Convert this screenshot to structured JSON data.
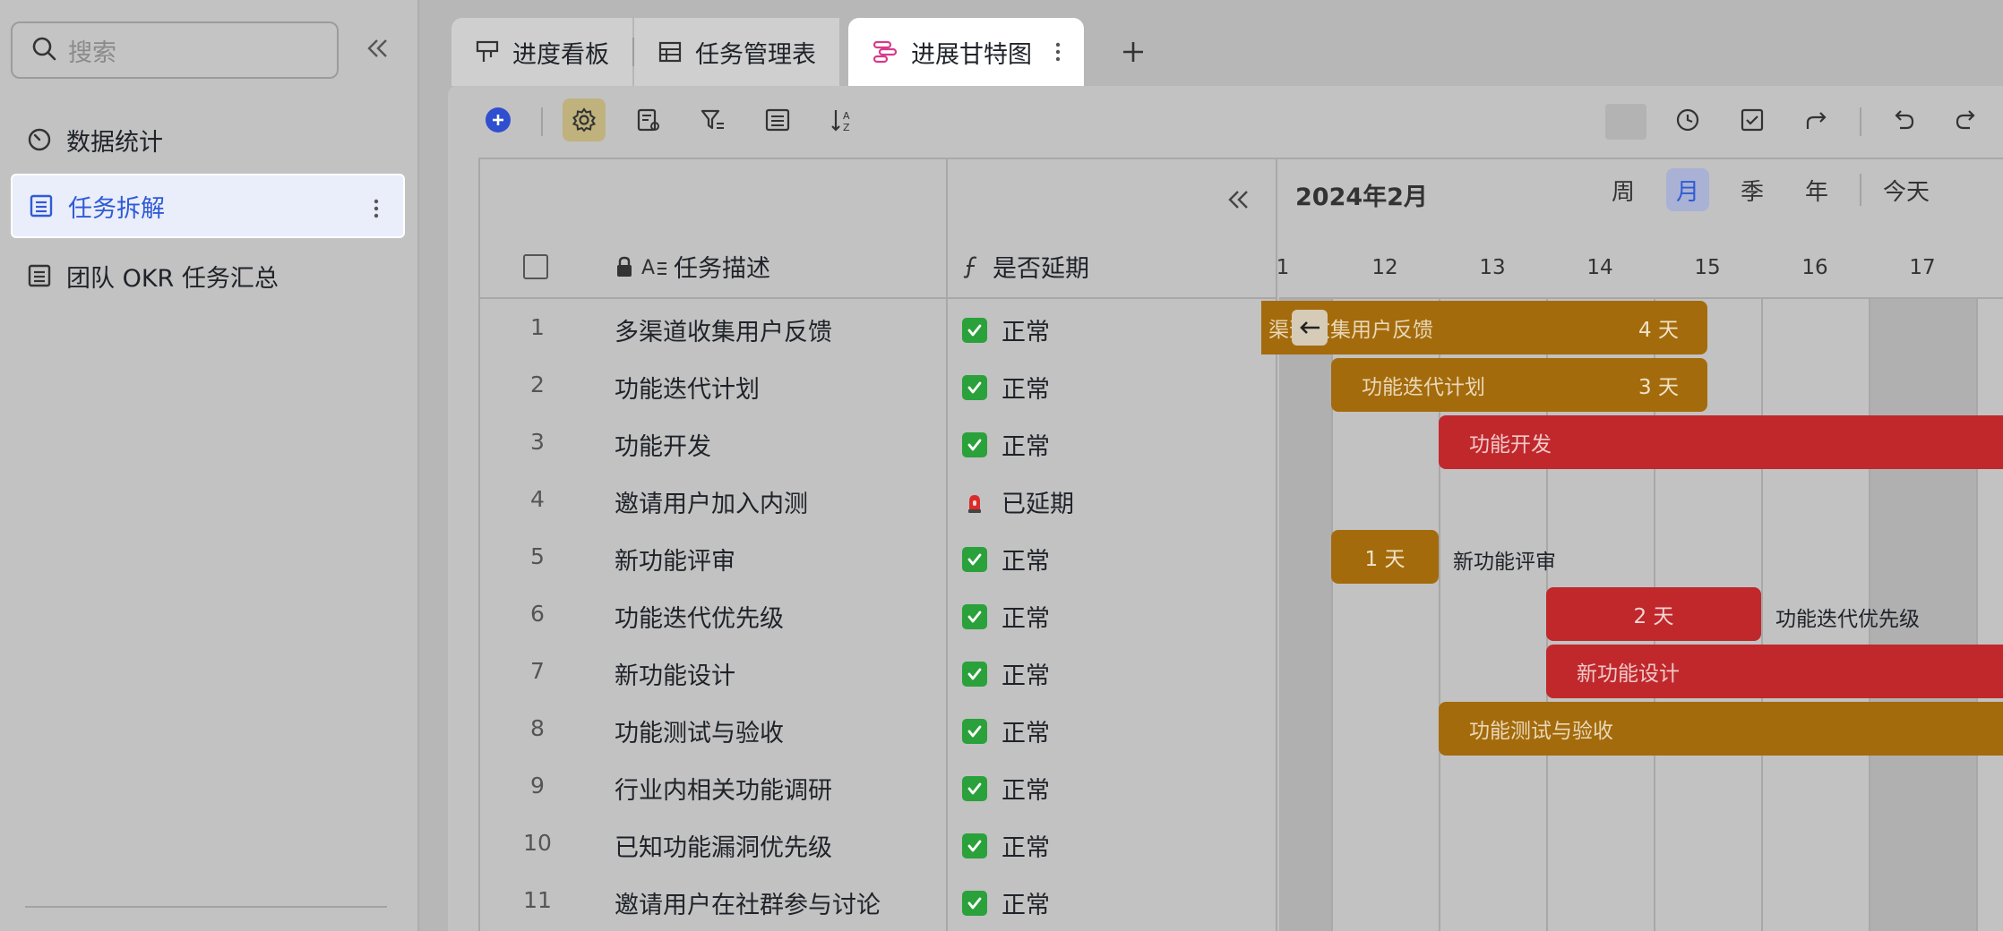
{
  "sidebar": {
    "search_placeholder": "搜索",
    "items": [
      {
        "label": "数据统计",
        "icon": "dashboard-icon"
      },
      {
        "label": "任务拆解",
        "icon": "table-icon",
        "active": true
      },
      {
        "label": "团队 OKR 任务汇总",
        "icon": "table-icon"
      }
    ]
  },
  "tabs": [
    {
      "label": "进度看板",
      "icon": "kanban-icon"
    },
    {
      "label": "任务管理表",
      "icon": "grid-icon"
    },
    {
      "label": "进展甘特图",
      "icon": "gantt-icon",
      "active": true
    }
  ],
  "table": {
    "headers": {
      "description": "任务描述",
      "delay": "是否延期"
    },
    "rows": [
      {
        "num": "1",
        "desc": "多渠道收集用户反馈",
        "status": "正常",
        "late": false
      },
      {
        "num": "2",
        "desc": "功能迭代计划",
        "status": "正常",
        "late": false
      },
      {
        "num": "3",
        "desc": "功能开发",
        "status": "正常",
        "late": false
      },
      {
        "num": "4",
        "desc": "邀请用户加入内测",
        "status": "已延期",
        "late": true
      },
      {
        "num": "5",
        "desc": "新功能评审",
        "status": "正常",
        "late": false
      },
      {
        "num": "6",
        "desc": "功能迭代优先级",
        "status": "正常",
        "late": false
      },
      {
        "num": "7",
        "desc": "新功能设计",
        "status": "正常",
        "late": false
      },
      {
        "num": "8",
        "desc": "功能测试与验收",
        "status": "正常",
        "late": false
      },
      {
        "num": "9",
        "desc": "行业内相关功能调研",
        "status": "正常",
        "late": false
      },
      {
        "num": "10",
        "desc": "已知功能漏洞优先级",
        "status": "正常",
        "late": false
      },
      {
        "num": "11",
        "desc": "邀请用户在社群参与讨论",
        "status": "正常",
        "late": false
      }
    ]
  },
  "gantt": {
    "month": "2024年2月",
    "views": [
      "周",
      "月",
      "季",
      "年"
    ],
    "active_view": "月",
    "today": "今天",
    "days": [
      "1",
      "12",
      "13",
      "14",
      "15",
      "16",
      "17"
    ],
    "bars": [
      {
        "row": 1,
        "label": "渠道收集用户反馈",
        "days_label": "4 天",
        "color": "gold",
        "start": 11,
        "end": 15
      },
      {
        "row": 2,
        "label": "功能迭代计划",
        "days_label": "3 天",
        "color": "gold",
        "start": 11.5,
        "end": 15
      },
      {
        "row": 3,
        "label": "功能开发",
        "days_label": "",
        "color": "red",
        "start": 12.5,
        "end": 19
      },
      {
        "row": 5,
        "label": "",
        "days_label": "1 天",
        "color": "gold",
        "start": 11.5,
        "end": 12.5,
        "outside": "新功能评审"
      },
      {
        "row": 6,
        "label": "",
        "days_label": "2 天",
        "color": "red",
        "start": 13.5,
        "end": 15.5,
        "outside": "功能迭代优先级"
      },
      {
        "row": 7,
        "label": "新功能设计",
        "days_label": "",
        "color": "red",
        "start": 13.5,
        "end": 19
      },
      {
        "row": 8,
        "label": "功能测试与验收",
        "days_label": "",
        "color": "gold",
        "start": 12.5,
        "end": 19
      }
    ],
    "colors": {
      "gold": "#a46b0c",
      "red": "#c0282c"
    }
  }
}
